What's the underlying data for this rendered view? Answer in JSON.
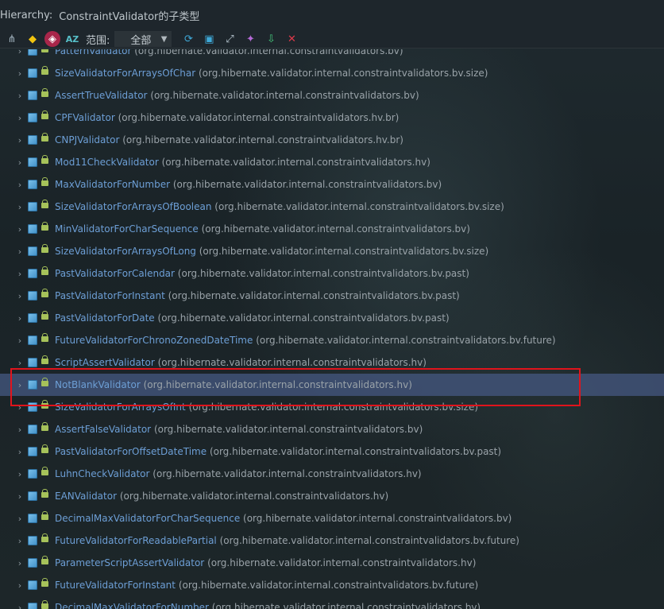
{
  "title": {
    "prefix": "Hierarchy:",
    "text": "ConstraintValidator的子类型"
  },
  "toolbar": {
    "scope_label": "范围:",
    "scope_value": "全部",
    "buttons": [
      {
        "name": "supertype-hierarchy-icon",
        "glyph": "⋔",
        "color": "#9fb0bb"
      },
      {
        "name": "class-hierarchy-icon",
        "glyph": "◆",
        "color": "#f1c40f"
      },
      {
        "name": "subtype-hierarchy-icon",
        "glyph": "◈",
        "color": "#e0365a"
      },
      {
        "name": "sort-alphabetically-icon",
        "glyph": "AZ",
        "color": "#57c0c9"
      }
    ],
    "actions": [
      {
        "name": "refresh-icon",
        "glyph": "⟳",
        "color": "#3fa9d8"
      },
      {
        "name": "terminal-icon",
        "glyph": "▣",
        "color": "#3fa9d8"
      },
      {
        "name": "expand-icon",
        "glyph": "⤢",
        "color": "#b8c7d1"
      },
      {
        "name": "pin-icon",
        "glyph": "✦",
        "color": "#b46ad6"
      },
      {
        "name": "export-icon",
        "glyph": "⇩",
        "color": "#43c37a"
      },
      {
        "name": "close-icon",
        "glyph": "✕",
        "color": "#e0394a"
      }
    ]
  },
  "tree": [
    {
      "name": "PatternValidator",
      "pkg": "(org.hibernate.validator.internal.constraintvalidators.bv)"
    },
    {
      "name": "SizeValidatorForArraysOfChar",
      "pkg": "(org.hibernate.validator.internal.constraintvalidators.bv.size)"
    },
    {
      "name": "AssertTrueValidator",
      "pkg": "(org.hibernate.validator.internal.constraintvalidators.bv)"
    },
    {
      "name": "CPFValidator",
      "pkg": "(org.hibernate.validator.internal.constraintvalidators.hv.br)"
    },
    {
      "name": "CNPJValidator",
      "pkg": "(org.hibernate.validator.internal.constraintvalidators.hv.br)"
    },
    {
      "name": "Mod11CheckValidator",
      "pkg": "(org.hibernate.validator.internal.constraintvalidators.hv)"
    },
    {
      "name": "MaxValidatorForNumber",
      "pkg": "(org.hibernate.validator.internal.constraintvalidators.bv)"
    },
    {
      "name": "SizeValidatorForArraysOfBoolean",
      "pkg": "(org.hibernate.validator.internal.constraintvalidators.bv.size)"
    },
    {
      "name": "MinValidatorForCharSequence",
      "pkg": "(org.hibernate.validator.internal.constraintvalidators.bv)"
    },
    {
      "name": "SizeValidatorForArraysOfLong",
      "pkg": "(org.hibernate.validator.internal.constraintvalidators.bv.size)"
    },
    {
      "name": "PastValidatorForCalendar",
      "pkg": "(org.hibernate.validator.internal.constraintvalidators.bv.past)"
    },
    {
      "name": "PastValidatorForInstant",
      "pkg": "(org.hibernate.validator.internal.constraintvalidators.bv.past)"
    },
    {
      "name": "PastValidatorForDate",
      "pkg": "(org.hibernate.validator.internal.constraintvalidators.bv.past)"
    },
    {
      "name": "FutureValidatorForChronoZonedDateTime",
      "pkg": "(org.hibernate.validator.internal.constraintvalidators.bv.future)"
    },
    {
      "name": "ScriptAssertValidator",
      "pkg": "(org.hibernate.validator.internal.constraintvalidators.hv)"
    },
    {
      "name": "NotBlankValidator",
      "pkg": "(org.hibernate.validator.internal.constraintvalidators.hv)",
      "selected": true
    },
    {
      "name": "SizeValidatorForArraysOfInt",
      "pkg": "(org.hibernate.validator.internal.constraintvalidators.bv.size)"
    },
    {
      "name": "AssertFalseValidator",
      "pkg": "(org.hibernate.validator.internal.constraintvalidators.bv)"
    },
    {
      "name": "PastValidatorForOffsetDateTime",
      "pkg": "(org.hibernate.validator.internal.constraintvalidators.bv.past)"
    },
    {
      "name": "LuhnCheckValidator",
      "pkg": "(org.hibernate.validator.internal.constraintvalidators.hv)"
    },
    {
      "name": "EANValidator",
      "pkg": "(org.hibernate.validator.internal.constraintvalidators.hv)"
    },
    {
      "name": "DecimalMaxValidatorForCharSequence",
      "pkg": "(org.hibernate.validator.internal.constraintvalidators.bv)"
    },
    {
      "name": "FutureValidatorForReadablePartial",
      "pkg": "(org.hibernate.validator.internal.constraintvalidators.bv.future)"
    },
    {
      "name": "ParameterScriptAssertValidator",
      "pkg": "(org.hibernate.validator.internal.constraintvalidators.hv)"
    },
    {
      "name": "FutureValidatorForInstant",
      "pkg": "(org.hibernate.validator.internal.constraintvalidators.bv.future)"
    },
    {
      "name": "DecimalMaxValidatorForNumber",
      "pkg": "(org.hibernate.validator.internal.constraintvalidators.bv)"
    }
  ],
  "colors": {
    "class_name": "#6d9fd6",
    "package": "#9aa3a9",
    "selection": "#46588299",
    "annotation_box": "#e0141c"
  }
}
